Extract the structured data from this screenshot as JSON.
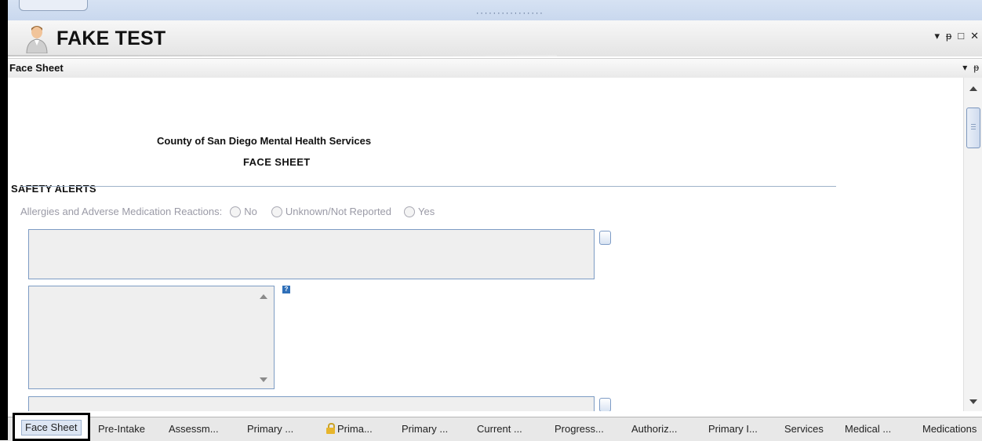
{
  "window": {
    "title": "FAKE TEST",
    "controls": [
      "▾",
      "ᵽ",
      "□",
      "✕"
    ]
  },
  "panel": {
    "title": "Face Sheet",
    "controls": [
      "▾",
      "ᵽ"
    ]
  },
  "form": {
    "org_name": "County of San Diego Mental Health Services",
    "sheet_title": "FACE SHEET",
    "section_safety": "SAFETY ALERTS",
    "allergies_label": "Allergies and Adverse Medication Reactions:",
    "allergy_options": [
      "No",
      "Unknown/Not Reported",
      "Yes"
    ]
  },
  "tabs": [
    {
      "label": "Face Sheet",
      "active": true
    },
    {
      "label": "Pre-Intake"
    },
    {
      "label": "Assessm..."
    },
    {
      "label": "Primary ..."
    },
    {
      "label": "Prima...",
      "icon": "lock-icon"
    },
    {
      "label": "Primary ..."
    },
    {
      "label": "Current ..."
    },
    {
      "label": "Progress..."
    },
    {
      "label": "Authoriz..."
    },
    {
      "label": "Primary I..."
    },
    {
      "label": "Services"
    },
    {
      "label": "Medical ..."
    },
    {
      "label": "Medications"
    }
  ],
  "colors": {
    "title_strip": "#d6e2f3",
    "field_border": "#7d9cc4",
    "field_fill": "#efefef",
    "disabled_text": "#9a9aa6"
  }
}
